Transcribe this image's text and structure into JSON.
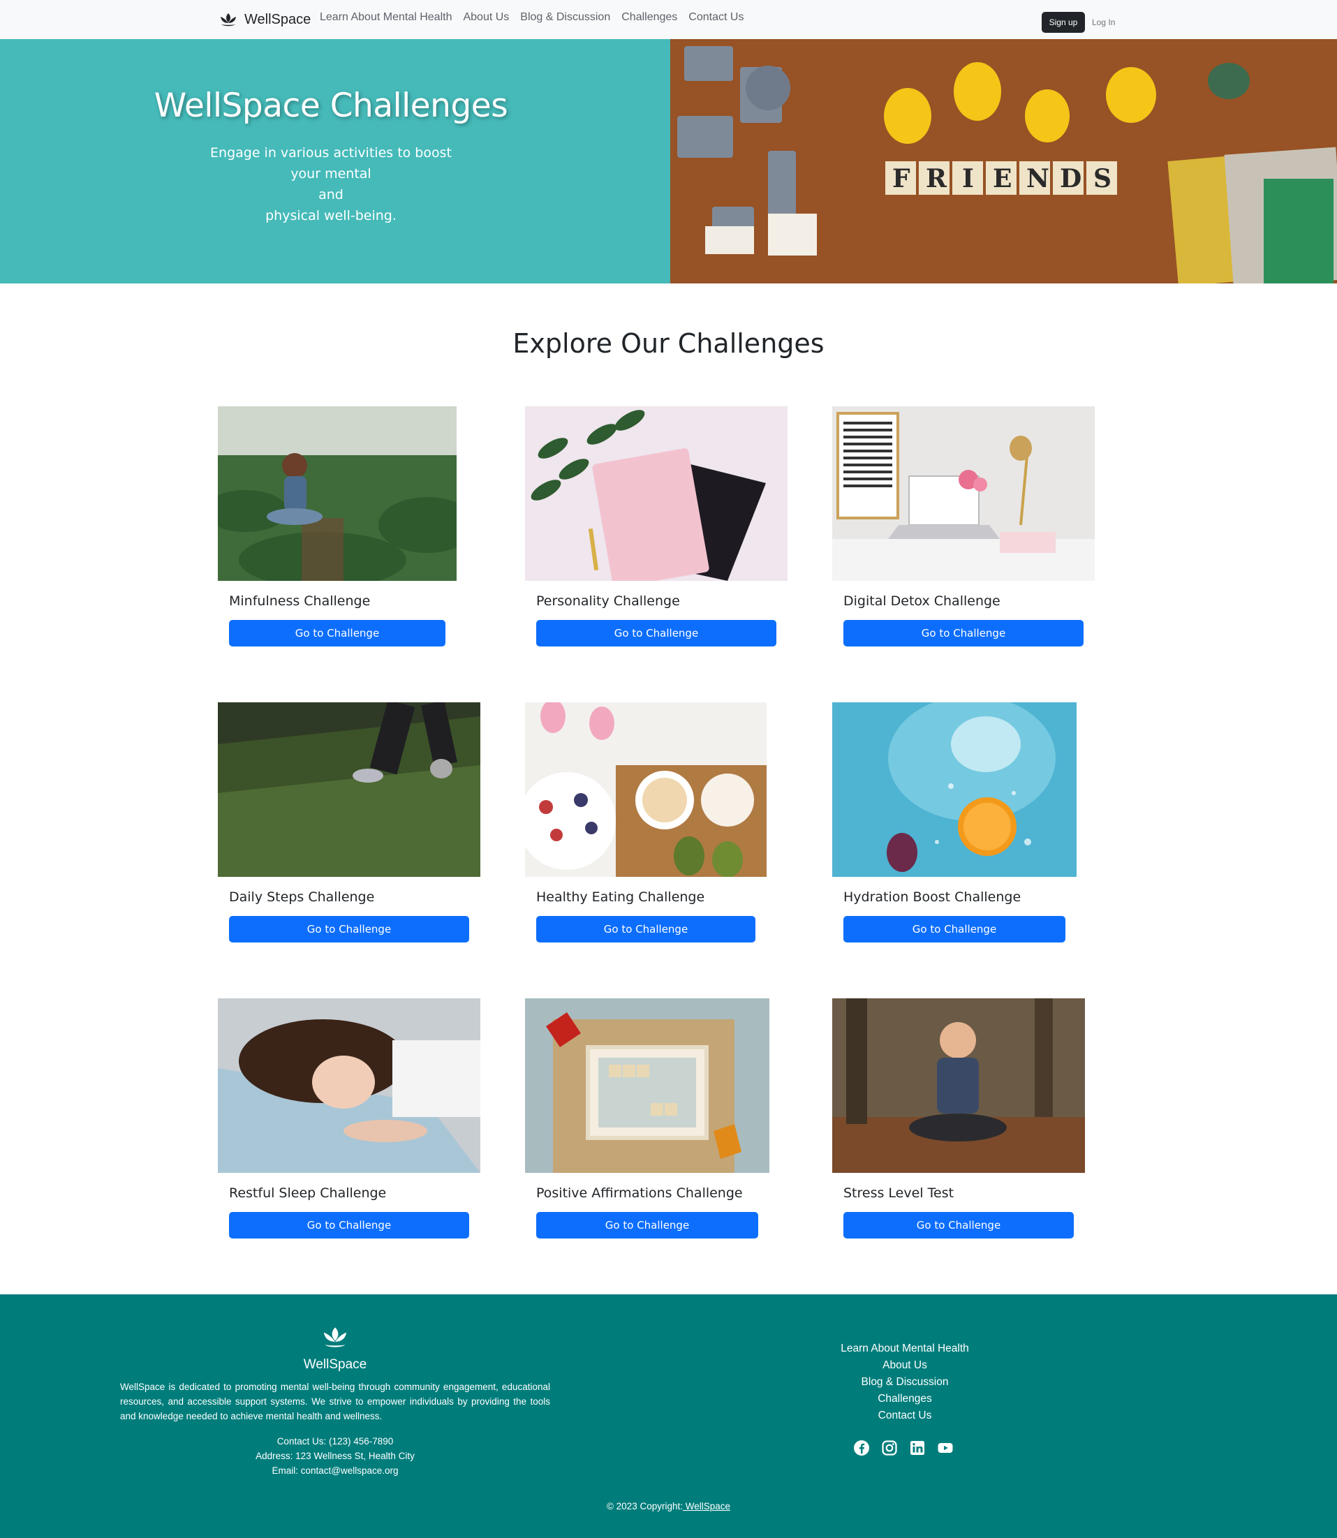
{
  "navbar": {
    "brand": "WellSpace",
    "links": [
      "Learn About Mental Health",
      "About Us",
      "Blog & Discussion",
      "Challenges",
      "Contact Us"
    ],
    "signup": "Sign up",
    "login": "Log In"
  },
  "hero": {
    "title": "WellSpace Challenges",
    "subtitle_lines": [
      "Engage in various activities to boost",
      "your mental",
      "and",
      "physical well-being."
    ],
    "image_caption": "FRIENDS"
  },
  "section": {
    "title": "Explore Our Challenges"
  },
  "cards": [
    {
      "title": "Minfulness Challenge",
      "button": "Go to Challenge",
      "image": "woman-meditating-in-field"
    },
    {
      "title": "Personality Challenge",
      "button": "Go to Challenge",
      "image": "gratitude-journal"
    },
    {
      "title": "Digital Detox Challenge",
      "button": "Go to Challenge",
      "image": "laptop-on-desk"
    },
    {
      "title": "Daily Steps Challenge",
      "button": "Go to Challenge",
      "image": "person-walking-on-grass"
    },
    {
      "title": "Healthy Eating Challenge",
      "button": "Go to Challenge",
      "image": "healthy-breakfast"
    },
    {
      "title": "Hydration Boost Challenge",
      "button": "Go to Challenge",
      "image": "fruit-in-water"
    },
    {
      "title": "Restful Sleep Challenge",
      "button": "Go to Challenge",
      "image": "woman-sleeping"
    },
    {
      "title": "Positive Affirmations Challenge",
      "button": "Go to Challenge",
      "image": "positive-attitude-tiles"
    },
    {
      "title": "Stress Level Test",
      "button": "Go to Challenge",
      "image": "woman-meditating-outdoors"
    }
  ],
  "footer": {
    "brand": "WellSpace",
    "description": "WellSpace is dedicated to promoting mental well-being through community engagement, educational resources, and accessible support systems. We strive to empower individuals by providing the tools and knowledge needed to achieve mental health and wellness.",
    "contact": [
      "Contact Us: (123) 456-7890",
      "Address: 123 Wellness St, Health City",
      "Email: contact@wellspace.org"
    ],
    "links": [
      "Learn About Mental Health",
      "About Us",
      "Blog & Discussion",
      "Challenges",
      "Contact Us"
    ],
    "social_icons": [
      "facebook-icon",
      "instagram-icon",
      "linkedin-icon",
      "youtube-icon"
    ],
    "copyright_prefix": "© 2023 Copyright:",
    "copyright_brand": " WellSpace"
  },
  "colors": {
    "hero_bg": "#45bab9",
    "footer_bg": "#007d7b",
    "button": "#0d6efd",
    "navbar_bg": "#f8f9fa"
  }
}
